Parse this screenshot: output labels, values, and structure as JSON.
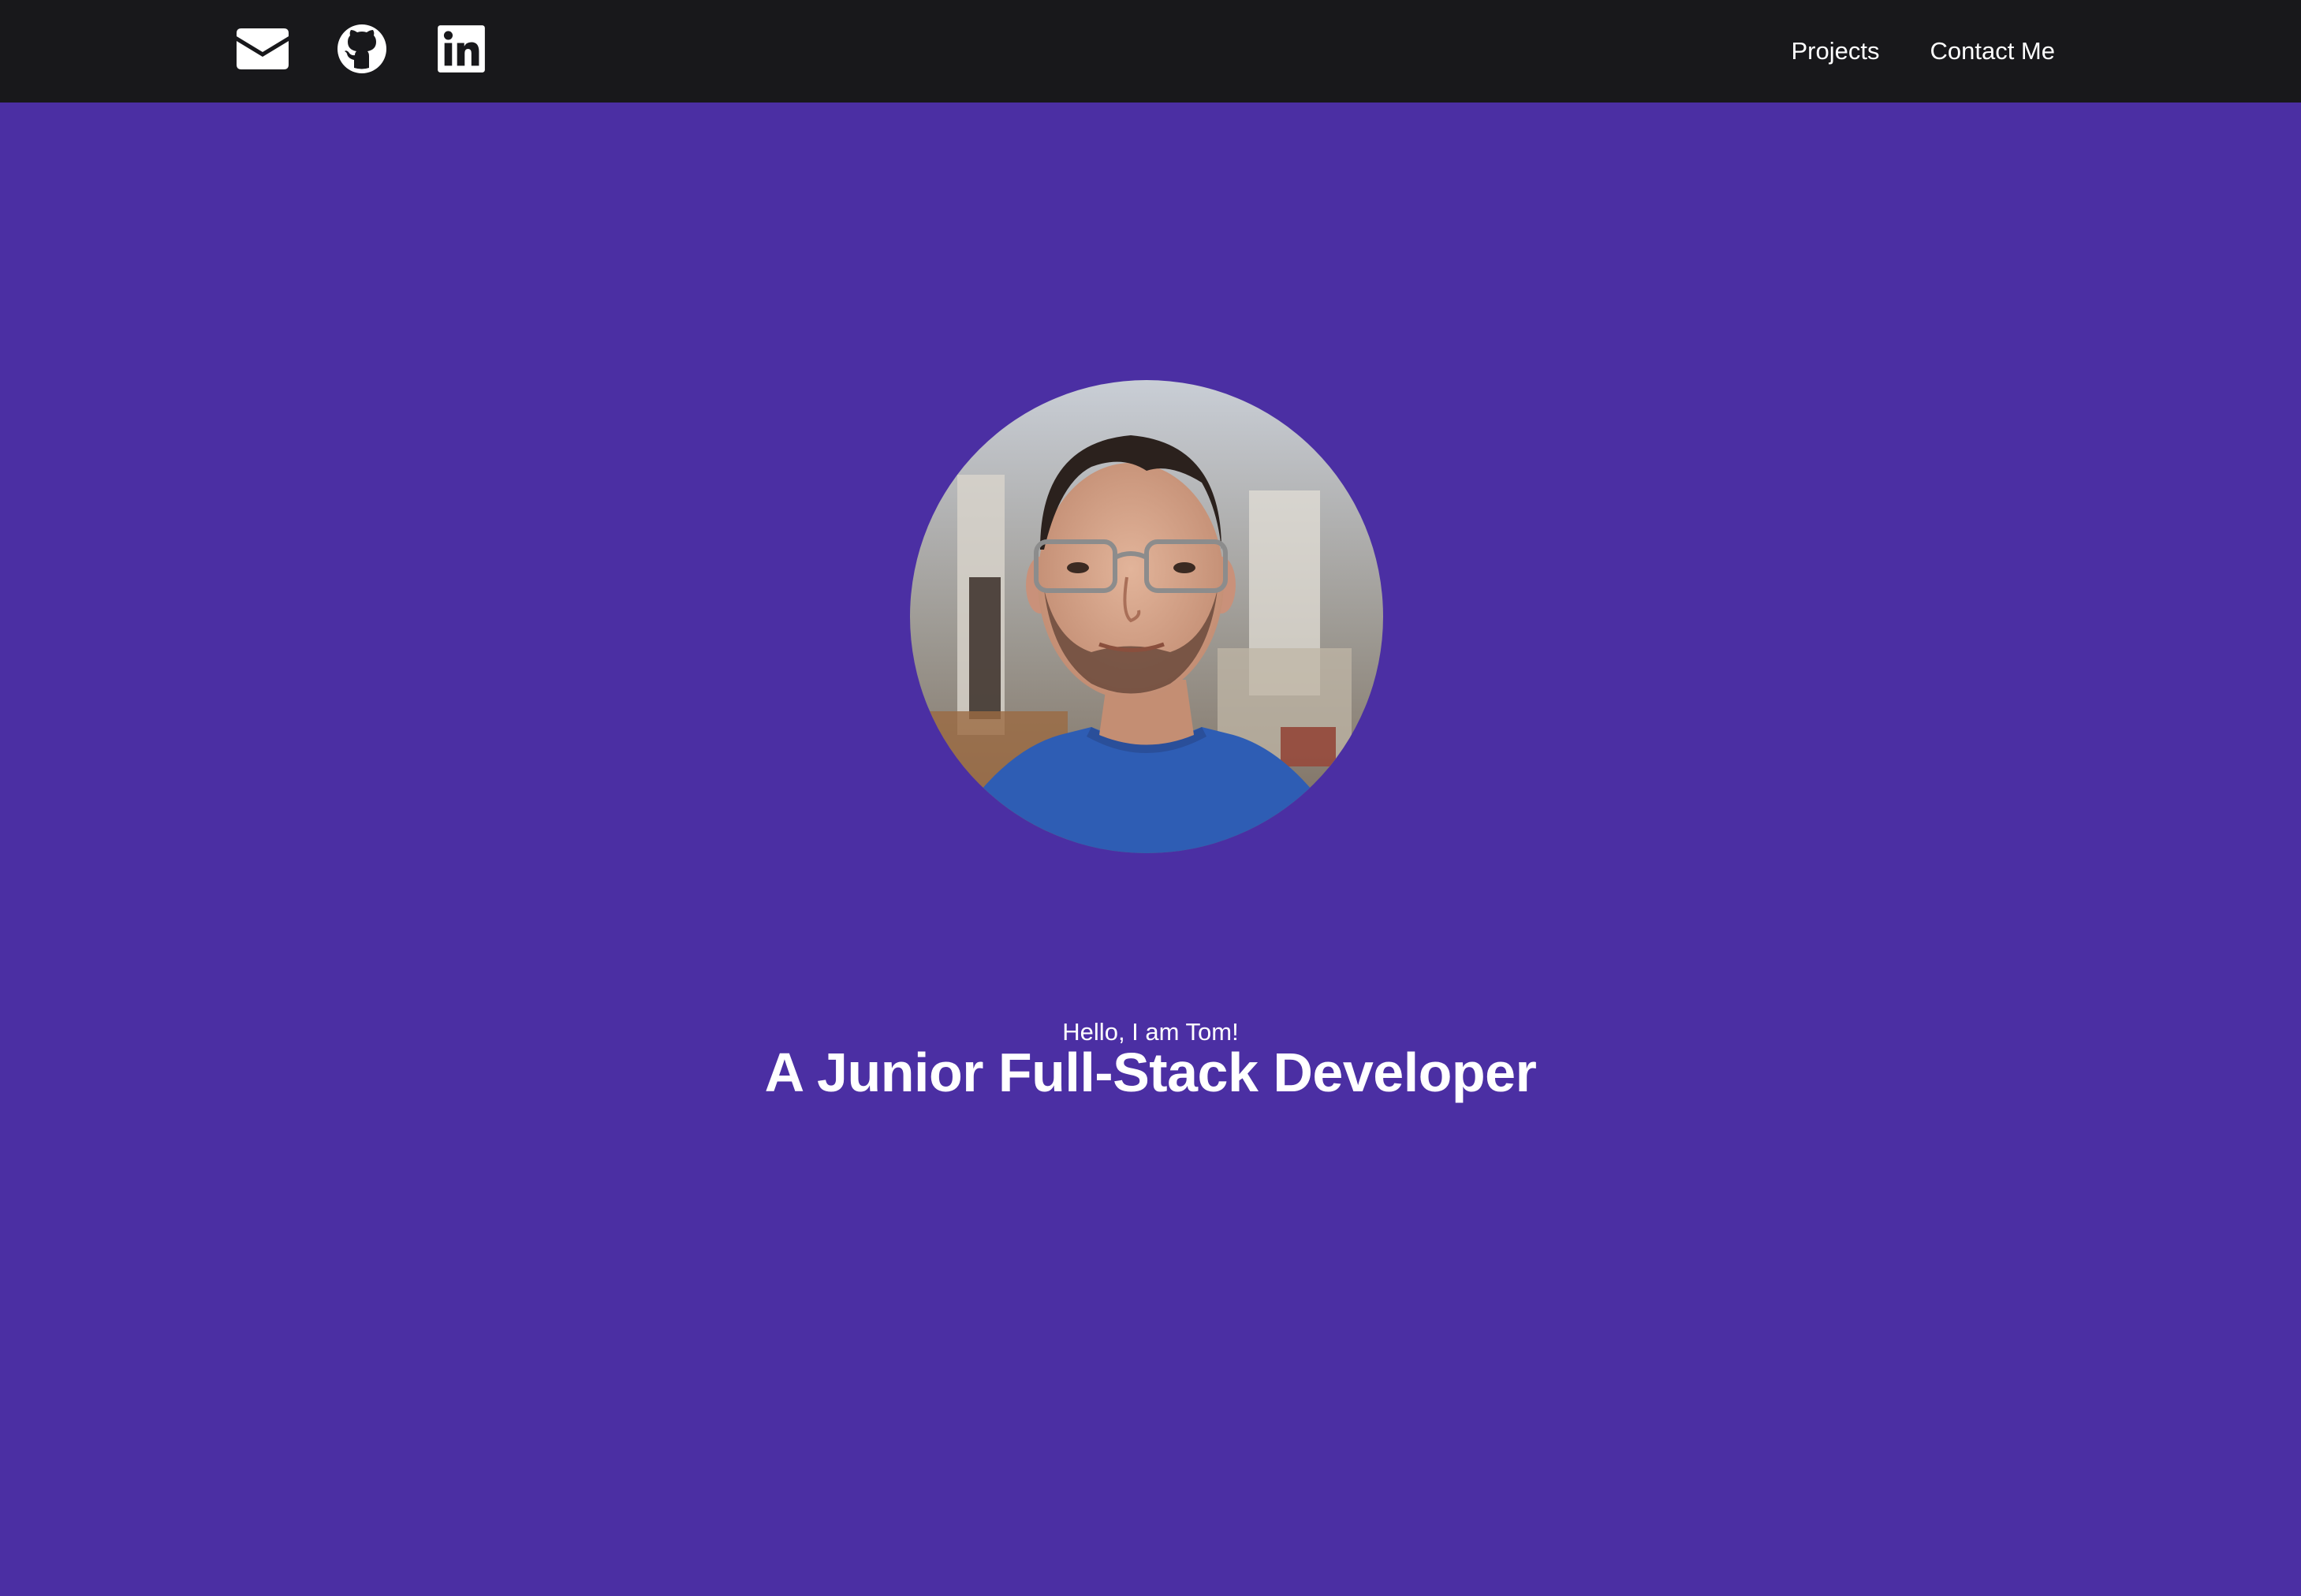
{
  "header": {
    "icons": [
      {
        "name": "email-icon",
        "label": "Email"
      },
      {
        "name": "github-icon",
        "label": "GitHub"
      },
      {
        "name": "linkedin-icon",
        "label": "LinkedIn"
      }
    ],
    "nav": [
      {
        "label": "Projects"
      },
      {
        "label": "Contact Me"
      }
    ]
  },
  "hero": {
    "avatar_icon": "profile-photo",
    "greeting": "Hello, I am Tom!",
    "headline": "A Junior Full-Stack Developer"
  },
  "colors": {
    "navbar_bg": "#18181b",
    "hero_bg": "#4b2fa3",
    "text": "#ffffff"
  }
}
